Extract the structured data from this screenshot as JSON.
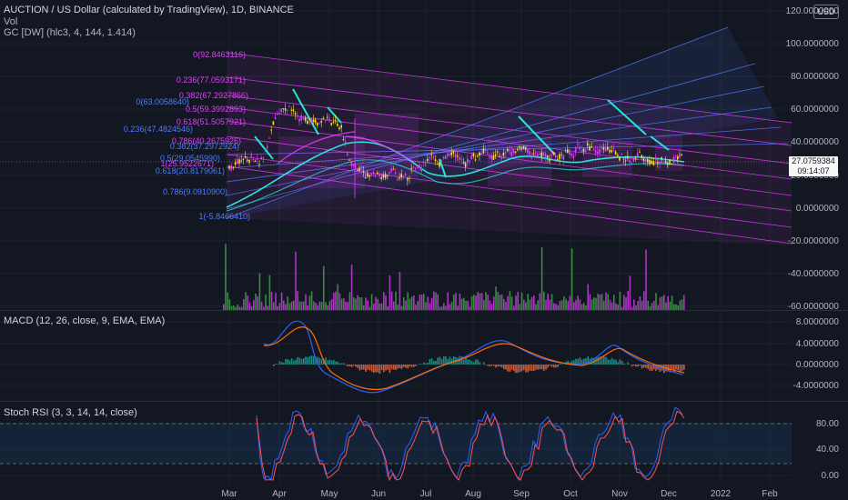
{
  "header": {
    "symbol_title": "AUCTION / US Dollar (calculated by TradingView), 1D, BINANCE",
    "vol_label": "Vol",
    "gc_label": "GC [DW] (hlc3, 4, 144, 1.414)",
    "currency_badge": "USD"
  },
  "price_axis": {
    "ticks": [
      "120.0000000",
      "100.0000000",
      "80.0000000",
      "60.0000000",
      "40.0000000",
      "20.0000000",
      "0.0000000",
      "-20.0000000",
      "-40.0000000",
      "-60.0000000"
    ],
    "last_price": "27.0759384",
    "countdown": "09:14:07"
  },
  "fib_labels": [
    {
      "text": "0(92.8463116)",
      "color": "#e040fb"
    },
    {
      "text": "0.236(77.0593171)",
      "color": "#e040fb"
    },
    {
      "text": "0.382(67.2927866)",
      "color": "#e040fb"
    },
    {
      "text": "0(63.0058640)",
      "color": "#4c7cff"
    },
    {
      "text": "0.5(59.3992893)",
      "color": "#e040fb"
    },
    {
      "text": "0.618(51.5057921)",
      "color": "#e040fb"
    },
    {
      "text": "0.236(47.4824546)",
      "color": "#4c7cff"
    },
    {
      "text": "0.786(40.2675926)",
      "color": "#e040fb"
    },
    {
      "text": "0.382(37.2972924)",
      "color": "#4c7cff"
    },
    {
      "text": "0.5(29.0545990)",
      "color": "#4c7cff"
    },
    {
      "text": "1(25.9522671)",
      "color": "#e040fb"
    },
    {
      "text": "0.618(20.8179061)",
      "color": "#4c7cff"
    },
    {
      "text": "0.786(9.0910900)",
      "color": "#4c7cff"
    },
    {
      "text": "1(-5.8466410)",
      "color": "#4c7cff"
    }
  ],
  "macd": {
    "legend": "MACD (12, 26, close, 9, EMA, EMA)",
    "ticks": [
      "8.0000000",
      "4.0000000",
      "0.0000000",
      "-4.0000000"
    ]
  },
  "stoch_rsi": {
    "legend": "Stoch RSI (3, 3, 14, 14, close)",
    "ticks": [
      "80.00",
      "40.00",
      "0.00"
    ]
  },
  "time_axis": {
    "labels": [
      "Mar",
      "Apr",
      "May",
      "Jun",
      "Jul",
      "Aug",
      "Sep",
      "Oct",
      "Nov",
      "Dec",
      "2022",
      "Feb"
    ]
  },
  "colors": {
    "background": "#131722",
    "fib_magenta": "#e040fb",
    "fib_blue": "#4c7cff",
    "ribbon_cyan": "#26e6d6",
    "candle_up": "#f7e12e",
    "candle_down": "#e040fb",
    "vol_up": "#4caf50",
    "vol_down": "#e040fb",
    "macd_line": "#2962ff",
    "signal_line": "#ff6d00",
    "rsi_k": "#2962ff",
    "rsi_d": "#ff5252"
  }
}
